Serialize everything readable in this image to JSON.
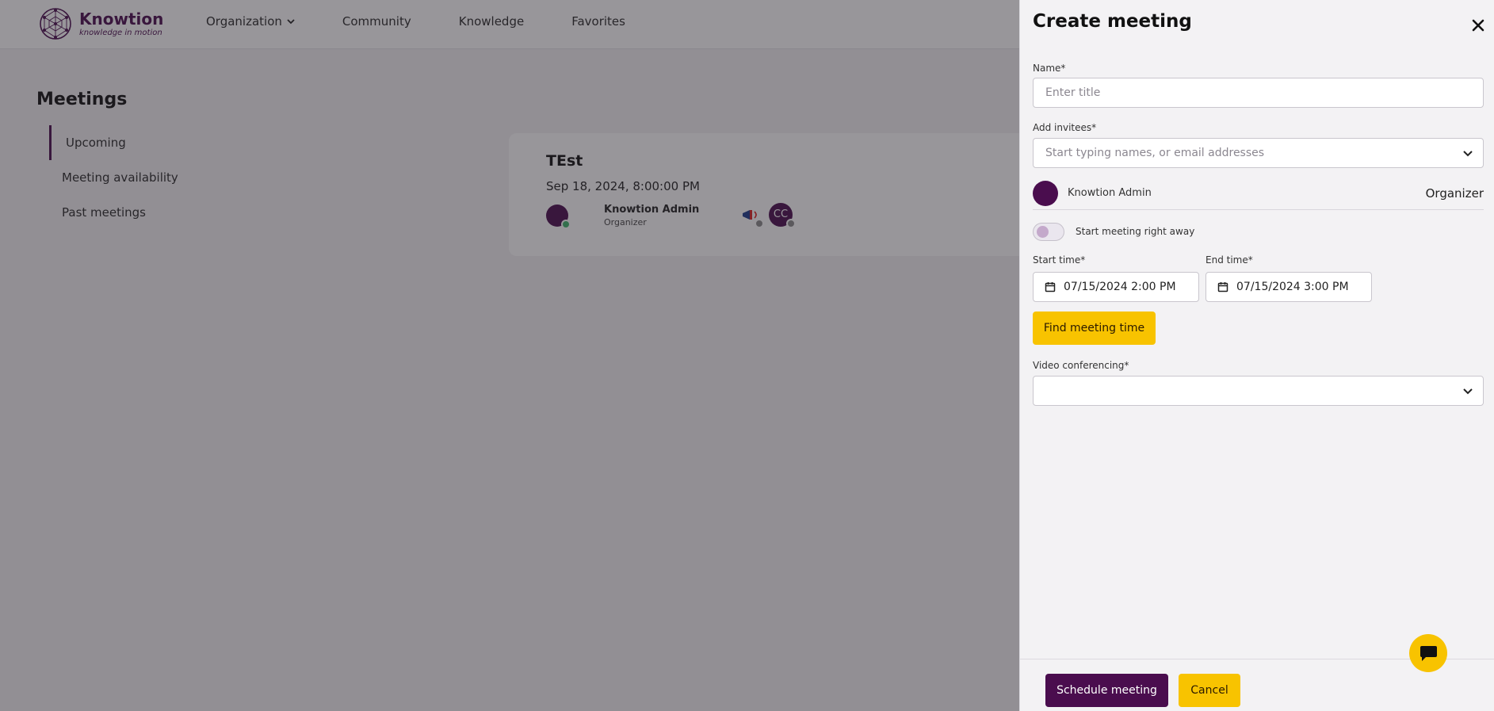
{
  "brand": {
    "name": "Knowtion",
    "tagline": "knowledge in motion"
  },
  "nav": {
    "items": [
      {
        "label": "Organization"
      },
      {
        "label": "Community"
      },
      {
        "label": "Knowledge"
      },
      {
        "label": "Favorites"
      }
    ]
  },
  "page": {
    "title": "Meetings"
  },
  "sidebar": {
    "items": [
      {
        "label": "Upcoming",
        "active": true
      },
      {
        "label": "Meeting availability",
        "active": false
      },
      {
        "label": "Past meetings",
        "active": false
      }
    ]
  },
  "meeting_card": {
    "title": "TEst",
    "datetime": "Sep 18, 2024, 8:00:00 PM",
    "organizer_name": "Knowtion Admin",
    "organizer_role": "Organizer",
    "invitee_initials": "CC"
  },
  "drawer": {
    "title": "Create meeting",
    "name_label": "Name*",
    "name_placeholder": "Enter title",
    "invitees_label": "Add invitees*",
    "invitees_placeholder": "Start typing names, or email addresses",
    "invitee": {
      "name": "Knowtion Admin",
      "role": "Organizer"
    },
    "start_now_label": "Start meeting right away",
    "start_now_on": false,
    "start_label": "Start time*",
    "start_value": "07/15/2024 2:00 PM",
    "end_label": "End time*",
    "end_value": "07/15/2024 3:00 PM",
    "find_time_label": "Find meeting time",
    "video_label": "Video conferencing*",
    "video_value": "",
    "schedule_label": "Schedule meeting",
    "cancel_label": "Cancel"
  },
  "colors": {
    "brand": "#4a0d4e",
    "accent": "#f8c300",
    "online": "#3fb56b"
  }
}
